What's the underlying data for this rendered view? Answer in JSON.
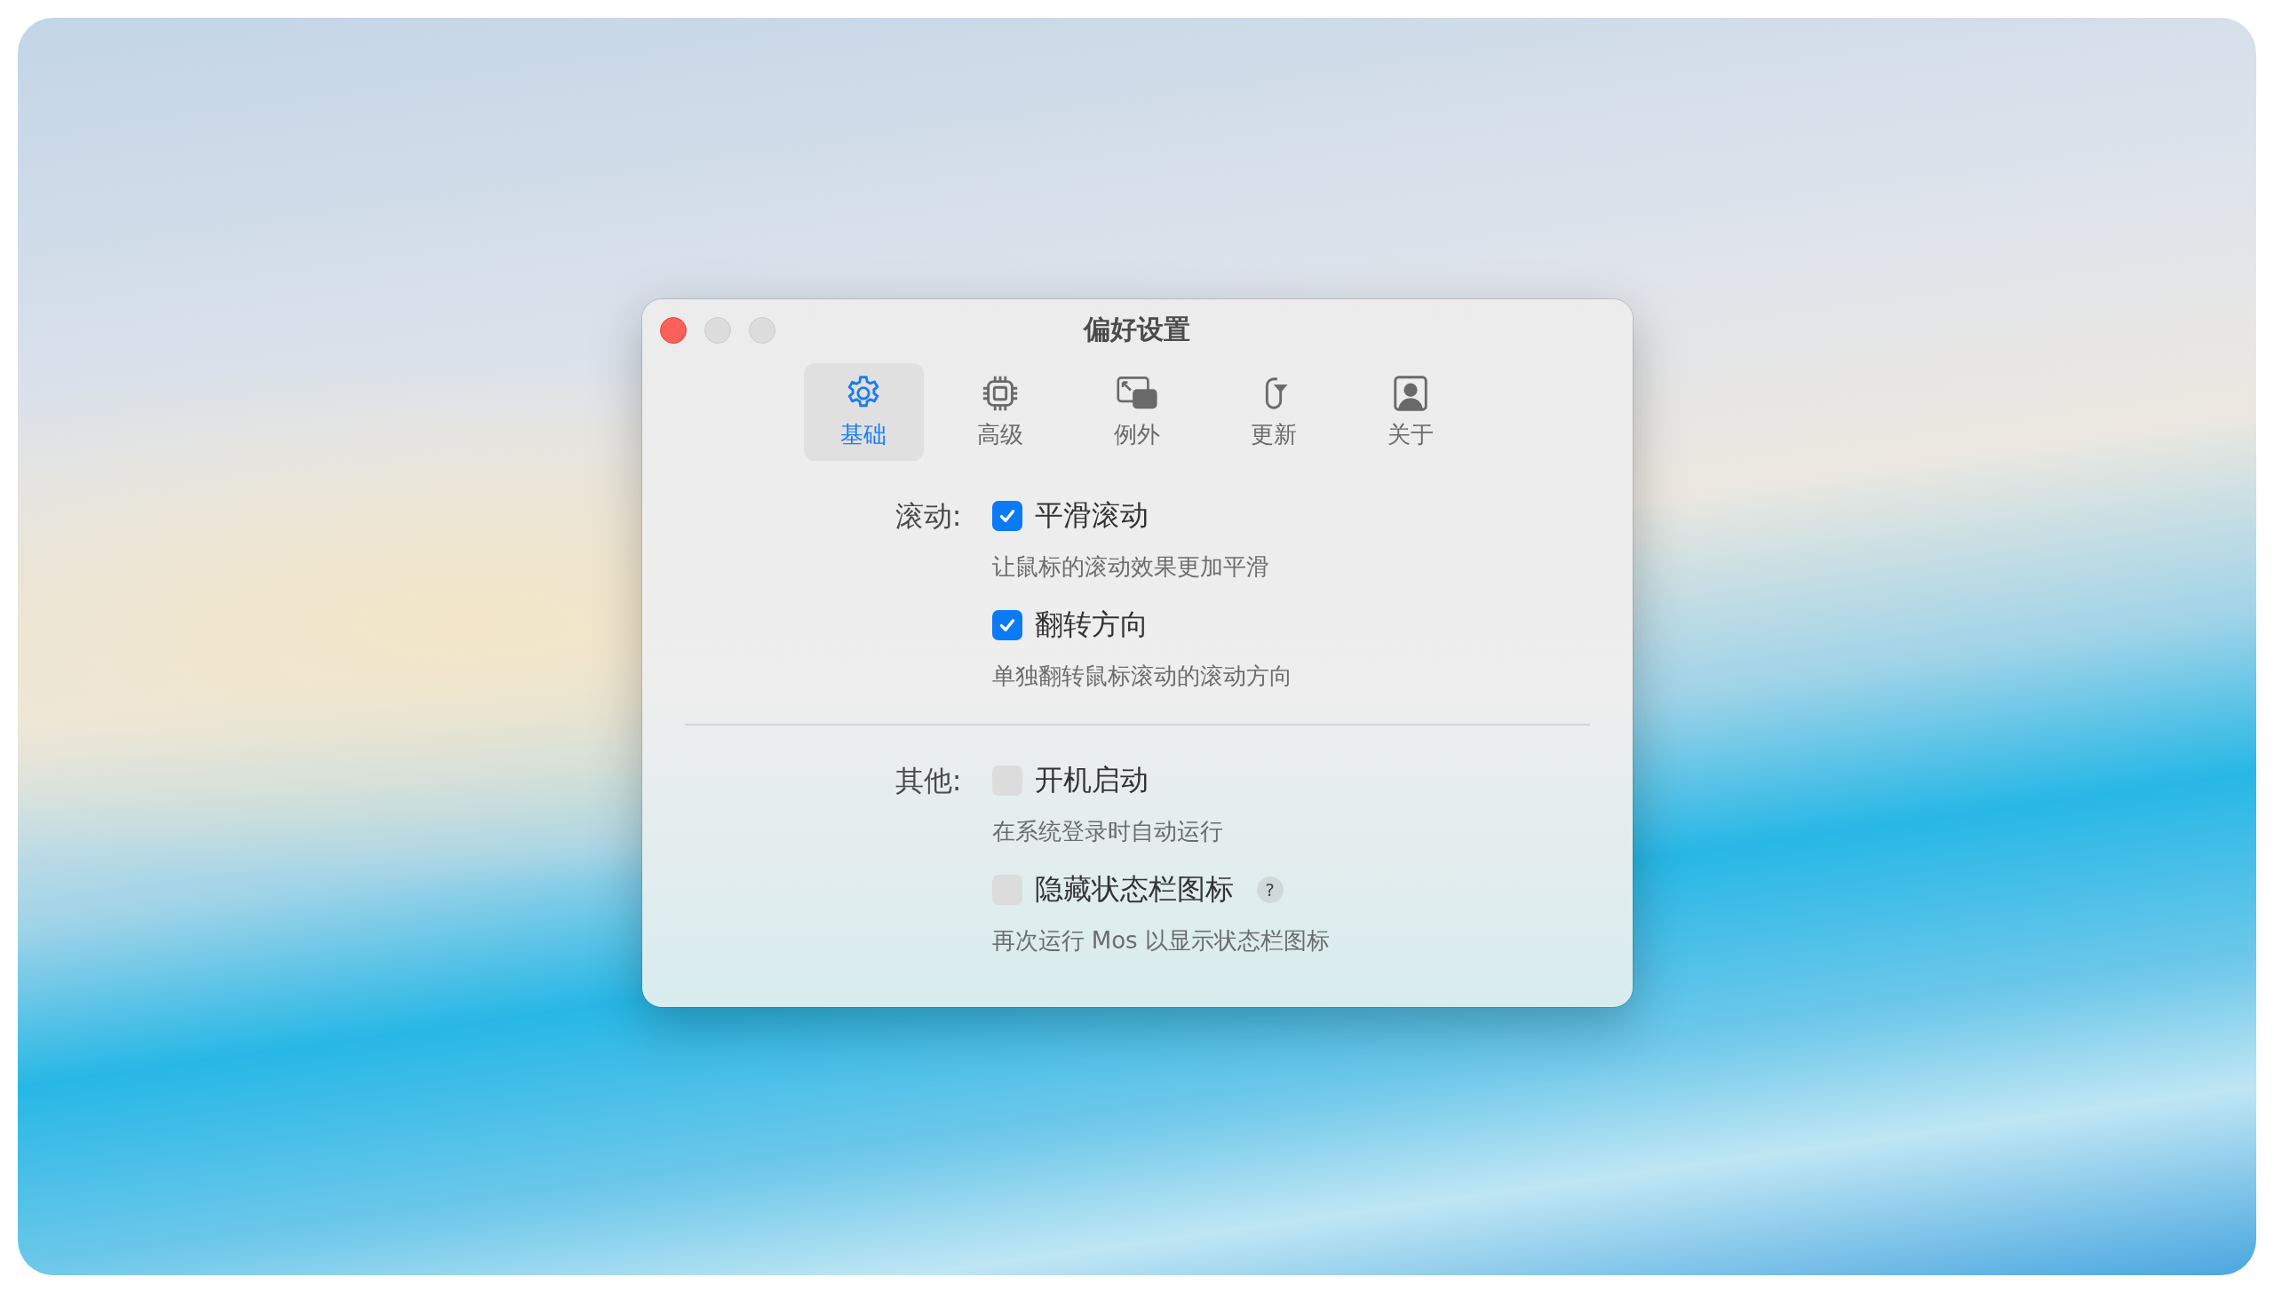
{
  "window": {
    "title": "偏好设置"
  },
  "tabs": [
    {
      "label": "基础",
      "kind": "gear",
      "selected": true
    },
    {
      "label": "高级",
      "kind": "chip",
      "selected": false
    },
    {
      "label": "例外",
      "kind": "windows",
      "selected": false
    },
    {
      "label": "更新",
      "kind": "refresh",
      "selected": false
    },
    {
      "label": "关于",
      "kind": "person",
      "selected": false
    }
  ],
  "sections": [
    {
      "label": "滚动:",
      "options": [
        {
          "label": "平滑滚动",
          "checked": true,
          "description": "让鼠标的滚动效果更加平滑"
        },
        {
          "label": "翻转方向",
          "checked": true,
          "description": "单独翻转鼠标滚动的滚动方向"
        }
      ]
    },
    {
      "label": "其他:",
      "options": [
        {
          "label": "开机启动",
          "checked": false,
          "description": "在系统登录时自动运行"
        },
        {
          "label": "隐藏状态栏图标",
          "checked": false,
          "help": "?",
          "description": "再次运行 Mos 以显示状态栏图标"
        }
      ]
    }
  ]
}
